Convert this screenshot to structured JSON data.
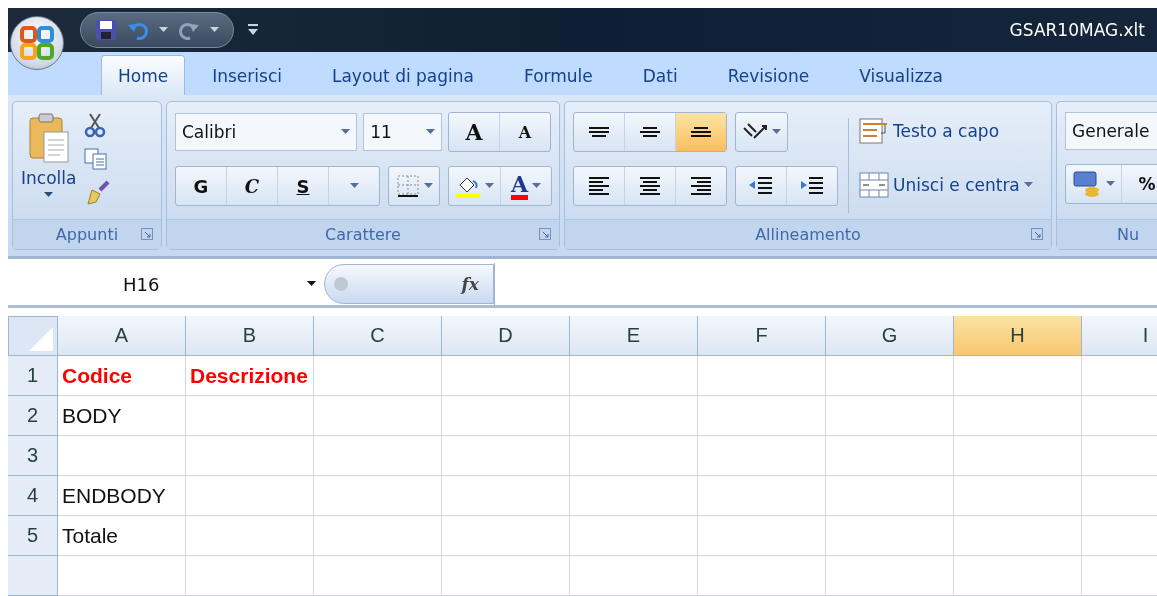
{
  "window": {
    "title": "GSAR10MAG.xlt"
  },
  "tabs": [
    {
      "label": "Home",
      "selected": true
    },
    {
      "label": "Inserisci",
      "selected": false
    },
    {
      "label": "Layout di pagina",
      "selected": false
    },
    {
      "label": "Formule",
      "selected": false
    },
    {
      "label": "Dati",
      "selected": false
    },
    {
      "label": "Revisione",
      "selected": false
    },
    {
      "label": "Visualizza",
      "selected": false
    }
  ],
  "ribbon": {
    "clipboard": {
      "label": "Appunti",
      "paste": "Incolla"
    },
    "font": {
      "label": "Carattere",
      "font_name": "Calibri",
      "font_size": "11",
      "grow": "A",
      "shrink": "A",
      "bold": "G",
      "italic": "C",
      "underline": "S",
      "font_color": "A"
    },
    "alignment": {
      "label": "Allineamento",
      "vertical": [
        {
          "kind": "top",
          "selected": false
        },
        {
          "kind": "middle",
          "selected": false
        },
        {
          "kind": "bottom",
          "selected": true
        }
      ],
      "horizontal": [
        {
          "kind": "left",
          "selected": false
        },
        {
          "kind": "center",
          "selected": false
        },
        {
          "kind": "right",
          "selected": false
        }
      ],
      "wrap": "Testo a capo",
      "merge": "Unisci e centra"
    },
    "number": {
      "label": "Nu",
      "format": "Generale",
      "percent": "%"
    }
  },
  "formula_bar": {
    "name_box": "H16",
    "fx": "fx"
  },
  "sheet": {
    "columns": [
      {
        "label": "A",
        "selected": false
      },
      {
        "label": "B",
        "selected": false
      },
      {
        "label": "C",
        "selected": false
      },
      {
        "label": "D",
        "selected": false
      },
      {
        "label": "E",
        "selected": false
      },
      {
        "label": "F",
        "selected": false
      },
      {
        "label": "G",
        "selected": false
      },
      {
        "label": "H",
        "selected": true
      },
      {
        "label": "I",
        "selected": false
      }
    ],
    "rows": [
      {
        "number": "1",
        "cells": [
          {
            "text": "Codice",
            "kind": "header"
          },
          {
            "text": "Descrizione",
            "kind": "header"
          }
        ]
      },
      {
        "number": "2",
        "cells": [
          {
            "text": "BODY",
            "kind": "plain"
          }
        ]
      },
      {
        "number": "3",
        "cells": []
      },
      {
        "number": "4",
        "cells": [
          {
            "text": "ENDBODY",
            "kind": "plain"
          }
        ]
      },
      {
        "number": "5",
        "cells": [
          {
            "text": "Totale",
            "kind": "plain"
          }
        ]
      }
    ]
  }
}
